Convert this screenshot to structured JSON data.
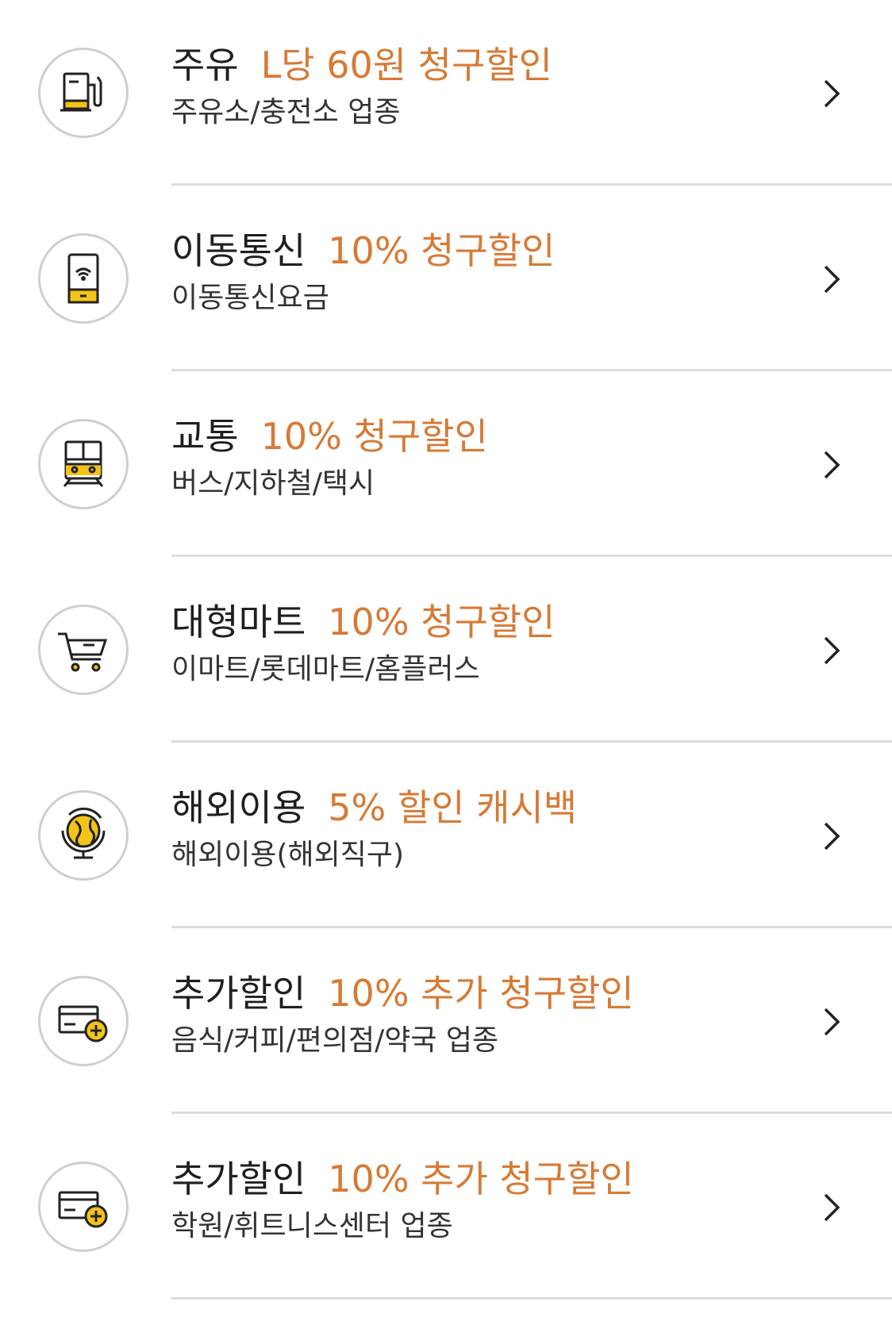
{
  "colors": {
    "accent": "#d77a35",
    "icon_yellow": "#f2c417",
    "divider": "#dcdcdc",
    "icon_stroke": "#222222"
  },
  "items": [
    {
      "title": "주유",
      "benefit": "L당 60원 청구할인",
      "subtitle": "주유소/충전소 업종",
      "icon": "fuel-pump-icon"
    },
    {
      "title": "이동통신",
      "benefit": "10% 청구할인",
      "subtitle": "이동통신요금",
      "icon": "mobile-phone-icon"
    },
    {
      "title": "교통",
      "benefit": "10% 청구할인",
      "subtitle": "버스/지하철/택시",
      "icon": "train-icon"
    },
    {
      "title": "대형마트",
      "benefit": "10% 청구할인",
      "subtitle": "이마트/롯데마트/홈플러스",
      "icon": "shopping-cart-icon"
    },
    {
      "title": "해외이용",
      "benefit": "5% 할인 캐시백",
      "subtitle": "해외이용(해외직구)",
      "icon": "globe-icon"
    },
    {
      "title": "추가할인",
      "benefit": "10% 추가 청구할인",
      "subtitle": "음식/커피/편의점/약국 업종",
      "icon": "card-plus-icon"
    },
    {
      "title": "추가할인",
      "benefit": "10% 추가 청구할인",
      "subtitle": "학원/휘트니스센터 업종",
      "icon": "card-plus-icon"
    }
  ]
}
